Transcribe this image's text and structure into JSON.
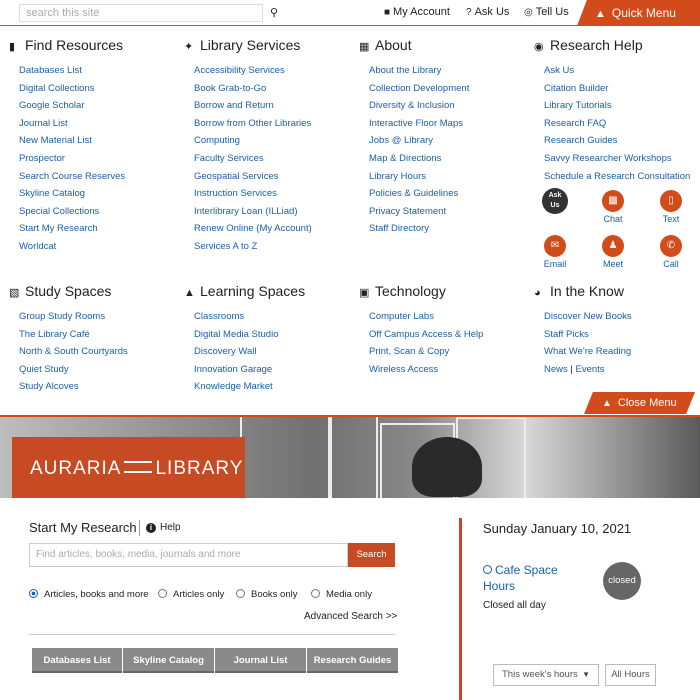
{
  "topbar": {
    "search_placeholder": "search this site",
    "my_account": "My Account",
    "ask_us": "Ask Us",
    "tell_us": "Tell Us",
    "quick_menu": "Quick Menu"
  },
  "menu": {
    "find_resources": {
      "title": "Find Resources",
      "items": [
        "Databases List",
        "Digital Collections",
        "Google Scholar",
        "Journal List",
        "New Material List",
        "Prospector",
        "Search Course Reserves",
        "Skyline Catalog",
        "Special Collections",
        "Start My Research",
        "Worldcat"
      ]
    },
    "library_services": {
      "title": "Library Services",
      "items": [
        "Accessibility Services",
        "Book Grab-to-Go",
        "Borrow and Return",
        "Borrow from Other Libraries",
        "Computing",
        "Faculty Services",
        "Geospatial Services",
        "Instruction Services",
        "Interlibrary Loan (ILLiad)",
        "Renew Online (My Account)",
        "Services A to Z"
      ]
    },
    "about": {
      "title": "About",
      "items": [
        "About the Library",
        "Collection Development",
        "Diversity & Inclusion",
        "Interactive Floor Maps",
        "Jobs @ Library",
        "Map & Directions",
        "Library Hours",
        "Policies & Guidelines",
        "Privacy Statement",
        "Staff Directory"
      ]
    },
    "research_help": {
      "title": "Research Help",
      "items": [
        "Ask Us",
        "Citation Builder",
        "Library Tutorials",
        "Research FAQ",
        "Research Guides",
        "Savvy Researcher Workshops",
        "Schedule a Research Consultation"
      ]
    },
    "contacts": {
      "ask_us_line1": "Ask",
      "ask_us_line2": "Us",
      "chat": "Chat",
      "text": "Text",
      "email": "Email",
      "meet": "Meet",
      "call": "Call"
    },
    "study_spaces": {
      "title": "Study Spaces",
      "items": [
        "Group Study Rooms",
        "The Library Café",
        "North & South Courtyards",
        "Quiet Study",
        "Study Alcoves"
      ]
    },
    "learning_spaces": {
      "title": "Learning Spaces",
      "items": [
        "Classrooms",
        "Digital Media Studio",
        "Discovery Wall",
        "Innovation Garage",
        "Knowledge Market"
      ]
    },
    "technology": {
      "title": "Technology",
      "items": [
        "Computer Labs",
        "Off Campus Access & Help",
        "Print, Scan & Copy",
        "Wireless Access"
      ]
    },
    "in_the_know": {
      "title": "In the Know",
      "items": [
        "Discover New Books",
        "Staff Picks",
        "What We're Reading"
      ],
      "news": "News",
      "separator": "|",
      "events": "Events"
    },
    "close_menu": "Close Menu"
  },
  "banner": {
    "logo_left": "AURARIA",
    "logo_right": "LIBRARY"
  },
  "research": {
    "title": "Start My Research",
    "help": "Help",
    "placeholder": "Find articles, books, media, journals and more",
    "search_button": "Search",
    "options": [
      "Articles, books and more",
      "Articles only",
      "Books only",
      "Media only"
    ],
    "selected_option": "Articles, books and more",
    "advanced": "Advanced Search >>",
    "tabs": [
      "Databases List",
      "Skyline Catalog",
      "Journal List",
      "Research Guides"
    ]
  },
  "hours": {
    "date": "Sunday January 10, 2021",
    "location": "Cafe Space Hours",
    "status_text": "Closed all day",
    "badge": "closed",
    "week_select": "This week's hours",
    "all_hours": "All Hours"
  },
  "colors": {
    "accent": "#d24b1a",
    "link": "#1a5fa8",
    "tab_bg": "#8a8a8a"
  }
}
